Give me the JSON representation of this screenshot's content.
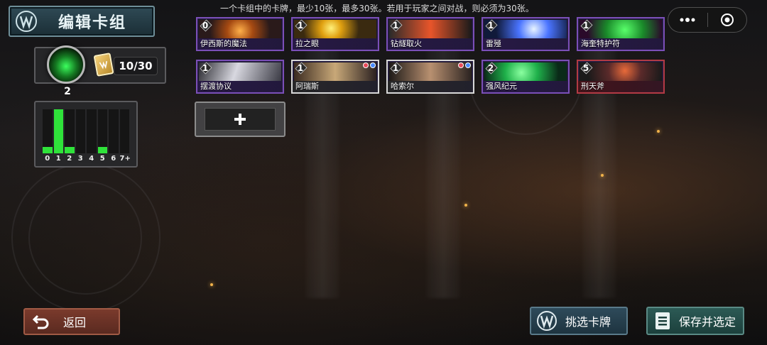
{
  "hint_text": "一个卡组中的卡牌，最少10张，最多30张。若用于玩家之间对战，则必须为30张。",
  "header": {
    "title": "编辑卡组"
  },
  "deck_count": "10/30",
  "hero_level": "2",
  "mana_curve": {
    "labels": [
      "0",
      "1",
      "2",
      "3",
      "4",
      "5",
      "6",
      "7+"
    ],
    "values": [
      1,
      7,
      1,
      0,
      0,
      1,
      0,
      0
    ]
  },
  "cards": [
    {
      "cost": "0",
      "name": "伊西斯的魔法",
      "rarity": "purple"
    },
    {
      "cost": "1",
      "name": "拉之眼",
      "rarity": "purple"
    },
    {
      "cost": "1",
      "name": "钻燧取火",
      "rarity": "purple"
    },
    {
      "cost": "1",
      "name": "雷殛",
      "rarity": "purple"
    },
    {
      "cost": "1",
      "name": "海奎特护符",
      "rarity": "purple"
    },
    {
      "cost": "1",
      "name": "摆渡协议",
      "rarity": "purple"
    },
    {
      "cost": "1",
      "name": "阿瑞斯",
      "rarity": "white"
    },
    {
      "cost": "1",
      "name": "哈索尔",
      "rarity": "white"
    },
    {
      "cost": "2",
      "name": "强风纪元",
      "rarity": "purple"
    },
    {
      "cost": "5",
      "name": "刑天斧",
      "rarity": "red"
    }
  ],
  "buttons": {
    "back": "返回",
    "filter": "挑选卡牌",
    "save": "保存并选定"
  },
  "colors": {
    "mana_fill": "#2fe33a",
    "purple_border": "#7a4fb8",
    "red_border": "#b23a44"
  }
}
